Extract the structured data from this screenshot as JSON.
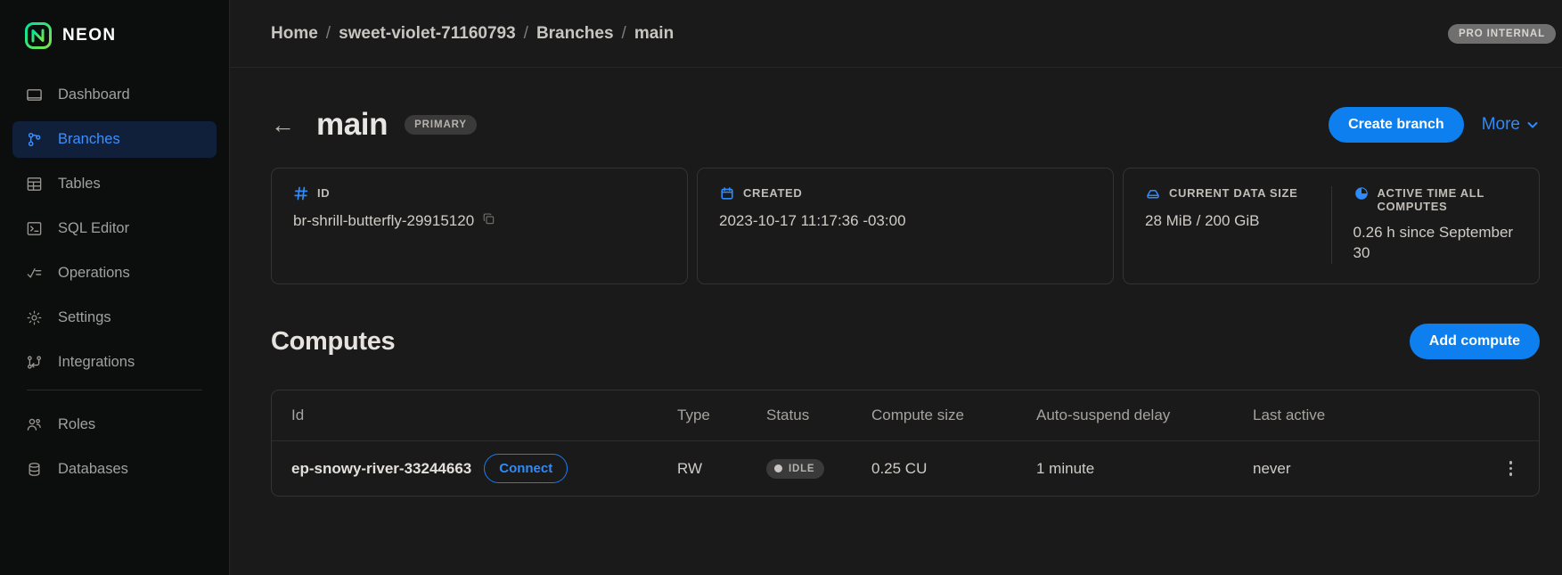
{
  "brand": {
    "name": "NEON",
    "logo_icon": "neon-logo-icon"
  },
  "sidebar": {
    "items": [
      {
        "label": "Dashboard",
        "icon": "dashboard-icon",
        "active": false
      },
      {
        "label": "Branches",
        "icon": "branches-icon",
        "active": true
      },
      {
        "label": "Tables",
        "icon": "table-icon",
        "active": false
      },
      {
        "label": "SQL Editor",
        "icon": "sql-editor-icon",
        "active": false
      },
      {
        "label": "Operations",
        "icon": "operations-icon",
        "active": false
      },
      {
        "label": "Settings",
        "icon": "gear-icon",
        "active": false
      },
      {
        "label": "Integrations",
        "icon": "integrations-icon",
        "active": false
      },
      {
        "label": "Roles",
        "icon": "users-icon",
        "active": false
      },
      {
        "label": "Databases",
        "icon": "database-icon",
        "active": false
      }
    ]
  },
  "topbar": {
    "breadcrumb": [
      "Home",
      "sweet-violet-71160793",
      "Branches",
      "main"
    ],
    "separator": "/",
    "plan_badge": "PRO INTERNAL"
  },
  "branch": {
    "back_icon": "arrow-left-icon",
    "title": "main",
    "badge": "PRIMARY",
    "create_branch_label": "Create branch",
    "more_label": "More",
    "more_icon": "chevron-down-icon"
  },
  "cards": [
    {
      "label": "ID",
      "icon": "hash-icon",
      "value": "br-shrill-butterfly-29915120",
      "copy_icon": "copy-icon"
    },
    {
      "label": "CREATED",
      "icon": "calendar-icon",
      "value": "2023-10-17 11:17:36 -03:00"
    },
    {
      "label": "CURRENT DATA SIZE",
      "icon": "database-size-icon",
      "value": "28 MiB / 200 GiB"
    },
    {
      "label": "ACTIVE TIME ALL COMPUTES",
      "icon": "clock-pie-icon",
      "value": "0.26 h since September 30"
    }
  ],
  "computes": {
    "title": "Computes",
    "add_button": "Add compute",
    "columns": [
      "Id",
      "Type",
      "Status",
      "Compute size",
      "Auto-suspend delay",
      "Last active"
    ],
    "rows": [
      {
        "id": "ep-snowy-river-33244663",
        "connect_label": "Connect",
        "type": "RW",
        "status": "IDLE",
        "compute_size": "0.25 CU",
        "autosuspend_delay": "1 minute",
        "last_active": "never",
        "menu_icon": "kebab-menu-icon"
      }
    ]
  },
  "colors": {
    "accent_blue": "#0e7fef",
    "link_blue": "#2f8bfb",
    "sidebar_bg": "#0c0d0d",
    "main_bg": "#1a1a1a",
    "logo_green": "#00e599"
  }
}
